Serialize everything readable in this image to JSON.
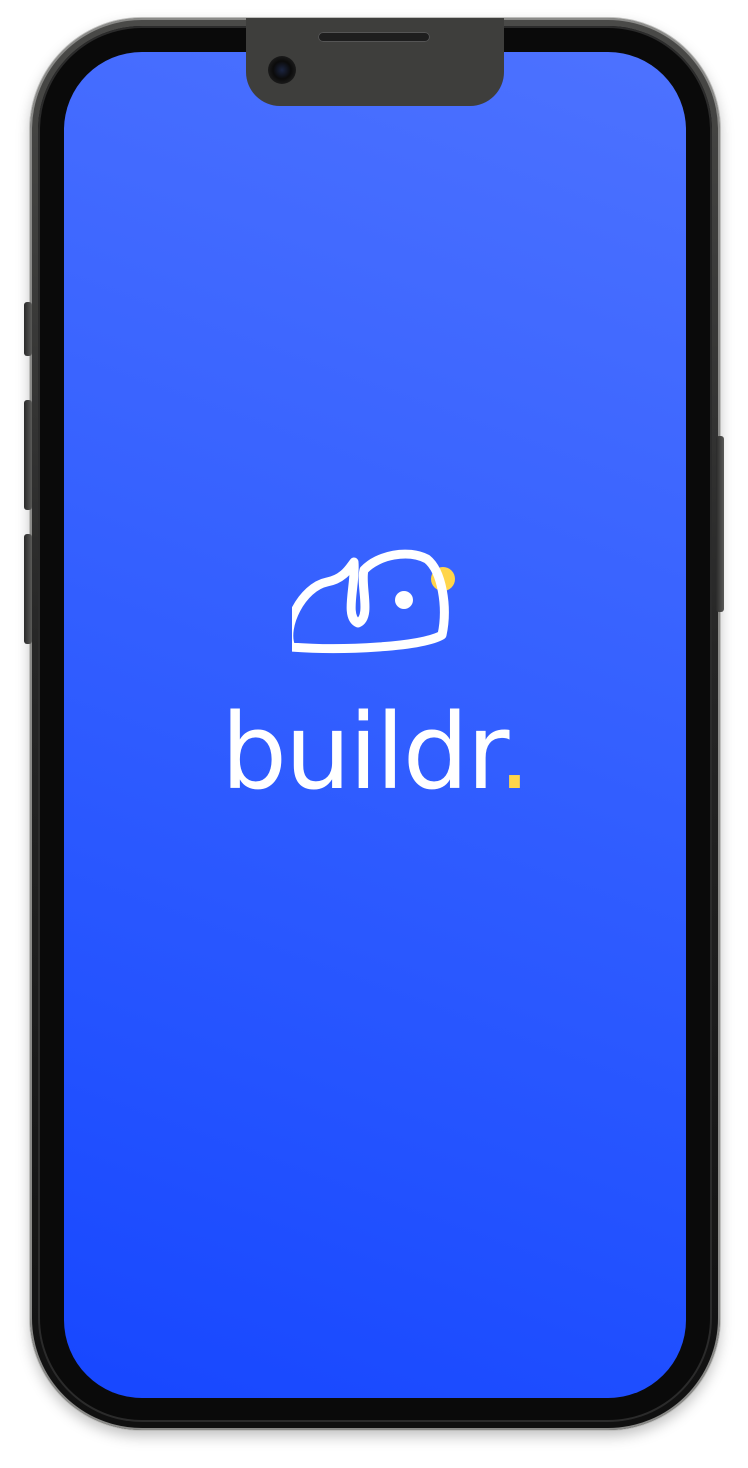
{
  "app": {
    "name": "buildr",
    "name_suffix": ".",
    "logo_icon": "buildr-logo-icon"
  },
  "colors": {
    "background_top": "#4d72ff",
    "background_bottom": "#1747ff",
    "logo_white": "#ffffff",
    "accent_yellow": "#ffd54a"
  }
}
